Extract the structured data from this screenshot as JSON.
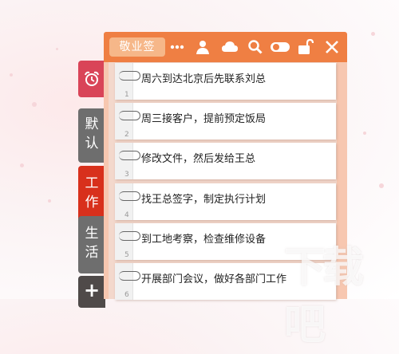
{
  "colors": {
    "titlebar": "#ef7f43",
    "tab_alarm": "#d94458",
    "tab_default": "#6e6e6e",
    "tab_work": "#d8301c",
    "tab_life": "#6e6e6e",
    "tab_add": "#4f4a49"
  },
  "toolbar": {
    "brand_label": "敬业签",
    "icons": [
      "more-icon",
      "user-icon",
      "cloud-icon",
      "search-icon",
      "toggle-icon",
      "unlock-icon",
      "close-icon"
    ]
  },
  "tabs": [
    {
      "name": "alarm",
      "icon": "alarm-clock-icon",
      "label": ""
    },
    {
      "name": "default",
      "label": "默认"
    },
    {
      "name": "work",
      "label": "工作"
    },
    {
      "name": "life",
      "label": "生活"
    },
    {
      "name": "add",
      "icon": "plus-icon",
      "label": "+"
    }
  ],
  "notes": [
    {
      "num": "1",
      "text": "周六到达北京后先联系刘总"
    },
    {
      "num": "2",
      "text": "周三接客户，提前预定饭局"
    },
    {
      "num": "3",
      "text": "修改文件，然后发给王总"
    },
    {
      "num": "4",
      "text": "找王总签字，制定执行计划"
    },
    {
      "num": "5",
      "text": "到工地考察，检查维修设备"
    },
    {
      "num": "6",
      "text": "开展部门会议，做好各部门工作"
    }
  ],
  "watermark": "下载吧"
}
